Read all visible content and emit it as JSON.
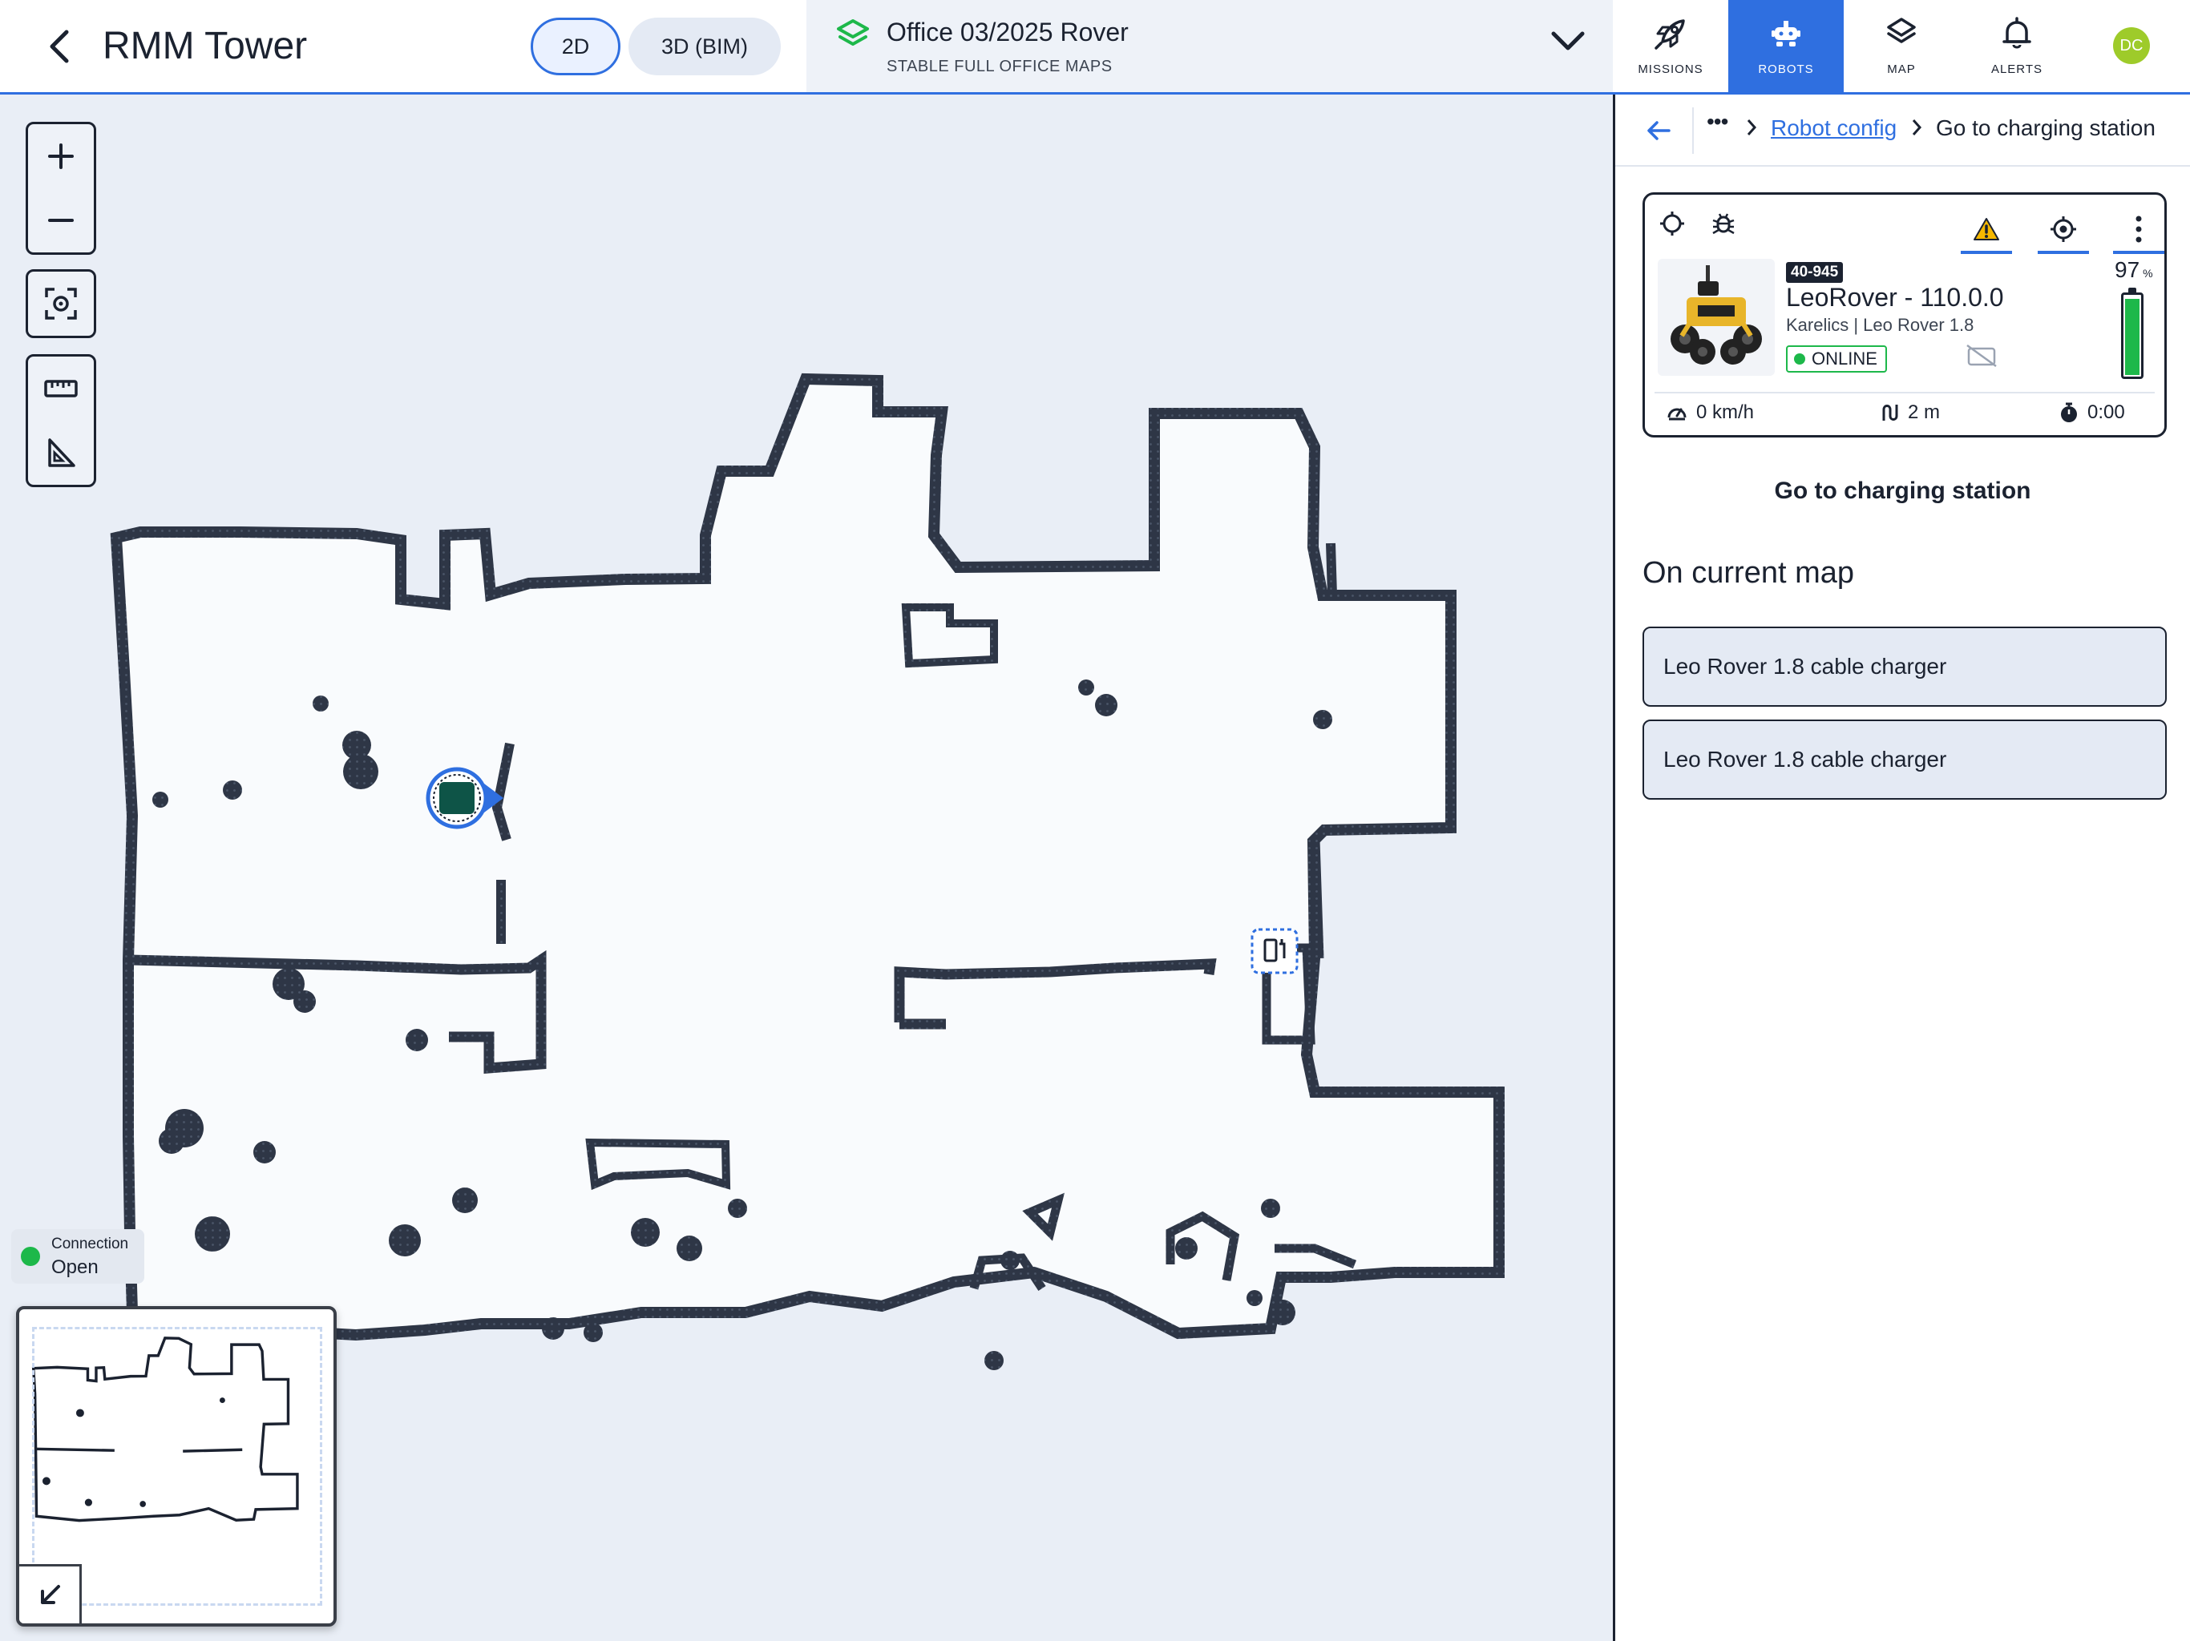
{
  "app": {
    "title": "RMM Tower"
  },
  "view_toggle": {
    "two_d": "2D",
    "three_d": "3D (BIM)",
    "selected": "2D"
  },
  "map_selector": {
    "name": "Office 03/2025 Rover",
    "subtitle": "STABLE FULL OFFICE MAPS"
  },
  "nav": {
    "items": [
      {
        "label": "MISSIONS",
        "icon": "rocket-icon",
        "active": false
      },
      {
        "label": "ROBOTS",
        "icon": "robot-icon",
        "active": true
      },
      {
        "label": "MAP",
        "icon": "layers-icon",
        "active": false
      },
      {
        "label": "ALERTS",
        "icon": "bell-icon",
        "active": false
      }
    ],
    "avatar_initials": "DC"
  },
  "connection": {
    "label": "Connection",
    "value": "Open",
    "color": "#1db84a"
  },
  "panel": {
    "breadcrumb": {
      "more": "•••",
      "link": "Robot config",
      "current": "Go to charging station"
    },
    "robot": {
      "id_badge": "40-945",
      "name": "LeoRover - 110.0.0",
      "model": "Karelics | Leo Rover 1.8",
      "status": "ONLINE",
      "battery_percent": 97,
      "battery_unit": "%",
      "speed": "0 km/h",
      "distance": "2 m",
      "time": "0:00"
    },
    "task_title": "Go to charging station",
    "section_title": "On current map",
    "chargers": [
      "Leo Rover 1.8 cable charger",
      "Leo Rover 1.8 cable charger"
    ]
  },
  "colors": {
    "accent": "#2f6fe0",
    "online": "#1db84a",
    "wall": "#2e3646",
    "floor": "#f9fbfd",
    "warning": "#f5b800"
  }
}
